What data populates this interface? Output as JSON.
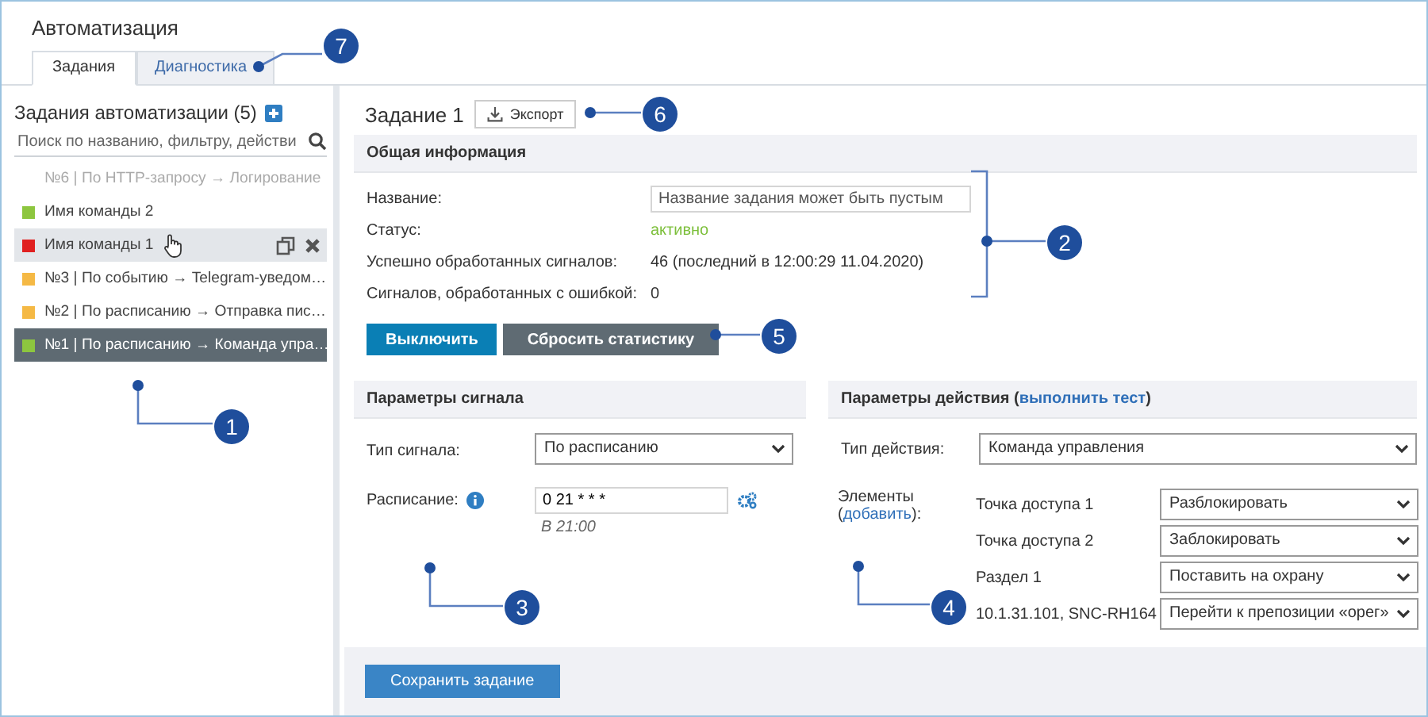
{
  "window": {
    "title": "Автоматизация"
  },
  "tabs": [
    {
      "label": "Задания",
      "selected": true
    },
    {
      "label": "Диагностика",
      "selected": false
    }
  ],
  "task_list": {
    "title": "Задания автоматизации (5)",
    "search": {
      "placeholder": "Поиск по названию, фильтру, действи"
    },
    "items": [
      {
        "label": "№6 | По HTTP-запросу → Логирование",
        "enabled": false,
        "selected": false,
        "hovered": false
      },
      {
        "label": "Имя команды 2",
        "enabled": true,
        "color": "#8dc63f",
        "selected": false,
        "hovered": false
      },
      {
        "label": "Имя команды 1",
        "enabled": true,
        "color": "#e02020",
        "selected": false,
        "hovered": true
      },
      {
        "label": "№3 | По событию → Telegram-уведом…",
        "enabled": true,
        "color": "#f5b945",
        "selected": false,
        "hovered": false
      },
      {
        "label": "№2 | По расписанию → Отправка пис…",
        "enabled": true,
        "color": "#f5b945",
        "selected": false,
        "hovered": false
      },
      {
        "label": "№1 | По расписанию → Команда упра…",
        "enabled": true,
        "color": "#8dc63f",
        "selected": true,
        "hovered": false
      }
    ]
  },
  "task": {
    "title": "Задание 1",
    "export_button": "Экспорт",
    "general": {
      "title": "Общая информация",
      "fields": [
        {
          "label": "Название:",
          "kind": "input",
          "placeholder": "Название задания может быть пустым"
        },
        {
          "label": "Статус:",
          "kind": "status",
          "value": "активно"
        },
        {
          "label": "Успешно обработанных сигналов:",
          "kind": "text",
          "value": "46 (последний в 12:00:29 11.04.2020)"
        },
        {
          "label": "Сигналов, обработанных с ошибкой:",
          "kind": "text",
          "value": "0"
        }
      ],
      "buttons": [
        {
          "label": "Выключить",
          "kind": "primary"
        },
        {
          "label": "Сбросить статистику",
          "kind": "secondary"
        }
      ]
    },
    "signal": {
      "title": "Параметры сигнала",
      "type_label": "Тип сигнала:",
      "type_value": "По расписанию",
      "schedule_label": "Расписание:",
      "schedule_value": "0 21 * * *",
      "schedule_hint": "В 21:00"
    },
    "action": {
      "title_prefix": "Параметры действия (",
      "test_link": "выполнить тест",
      "title_suffix": ")",
      "type_label": "Тип действия:",
      "type_value": "Команда управления",
      "elements_label": "Элементы",
      "add_prefix": "(",
      "add_link": "добавить",
      "add_suffix": "):",
      "elements": [
        {
          "name": "Точка доступа 1",
          "command": "Разблокировать"
        },
        {
          "name": "Точка доступа 2",
          "command": "Заблокировать"
        },
        {
          "name": "Раздел 1",
          "command": "Поставить на охрану"
        },
        {
          "name": "10.1.31.101, SNC-RH164",
          "command": "Перейти к препозиции «opeг»"
        }
      ]
    },
    "save_button": "Сохранить задание"
  },
  "callouts": [
    {
      "number": "1"
    },
    {
      "number": "2"
    },
    {
      "number": "3"
    },
    {
      "number": "4"
    },
    {
      "number": "5"
    },
    {
      "number": "6"
    },
    {
      "number": "7"
    }
  ]
}
